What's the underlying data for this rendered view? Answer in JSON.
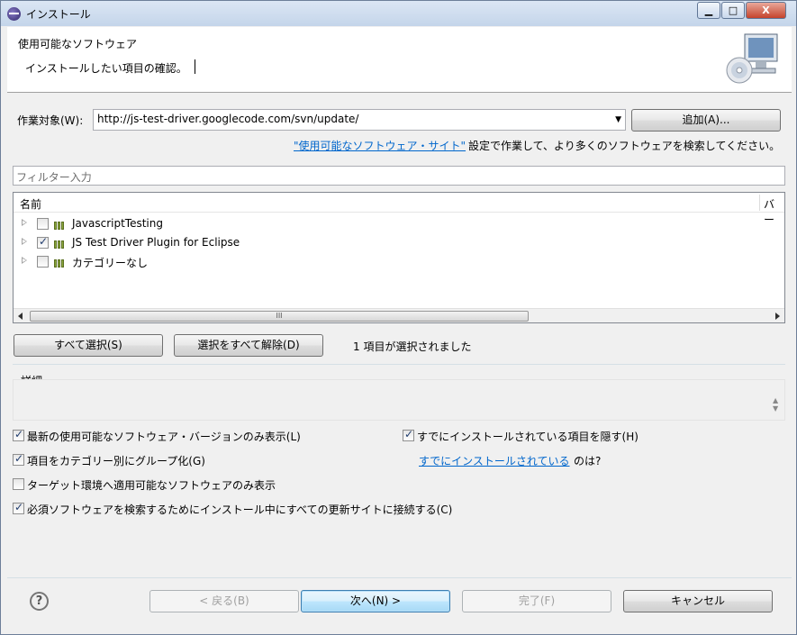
{
  "window": {
    "title": "インストール",
    "btn_min": "▁",
    "btn_max": "□",
    "btn_close": "X"
  },
  "header": {
    "title": "使用可能なソフトウェア",
    "message": "インストールしたい項目の確認。",
    "icon": "monitor-cd-icon"
  },
  "work_with": {
    "label": "作業対象(W):",
    "value": "http://js-test-driver.googlecode.com/svn/update/",
    "add_button": "追加(A)...",
    "hint_link": "\"使用可能なソフトウェア・サイト\"",
    "hint_text": "設定で作業して、より多くのソフトウェアを検索してください。"
  },
  "filter": {
    "placeholder": "フィルター入力"
  },
  "tree": {
    "columns": [
      "名前",
      "バー"
    ],
    "items": [
      {
        "label": "JavascriptTesting",
        "checked": false
      },
      {
        "label": "JS Test Driver Plugin for Eclipse",
        "checked": true
      },
      {
        "label": "カテゴリーなし",
        "checked": false
      }
    ],
    "scroll_grip": "III"
  },
  "selection": {
    "select_all": "すべて選択(S)",
    "deselect_all": "選択をすべて解除(D)",
    "status": "1 項目が選択されました"
  },
  "details": {
    "label": "詳細"
  },
  "options": {
    "latest_only": {
      "label": "最新の使用可能なソフトウェア・バージョンのみ表示(L)",
      "checked": true
    },
    "group_by_category": {
      "label": "項目をカテゴリー別にグループ化(G)",
      "checked": true
    },
    "target_only": {
      "label": "ターゲット環境へ適用可能なソフトウェアのみ表示",
      "checked": false
    },
    "contact_all": {
      "label": "必須ソフトウェアを検索するためにインストール中にすべての更新サイトに接続する(C)",
      "checked": true
    },
    "hide_installed": {
      "label": "すでにインストールされている項目を隠す(H)",
      "checked": true
    },
    "installed_link": "すでにインストールされている",
    "installed_suffix": "のは?"
  },
  "footer": {
    "help": "?",
    "back": "< 戻る(B)",
    "next": "次へ(N) >",
    "finish": "完了(F)",
    "cancel": "キャンセル"
  }
}
